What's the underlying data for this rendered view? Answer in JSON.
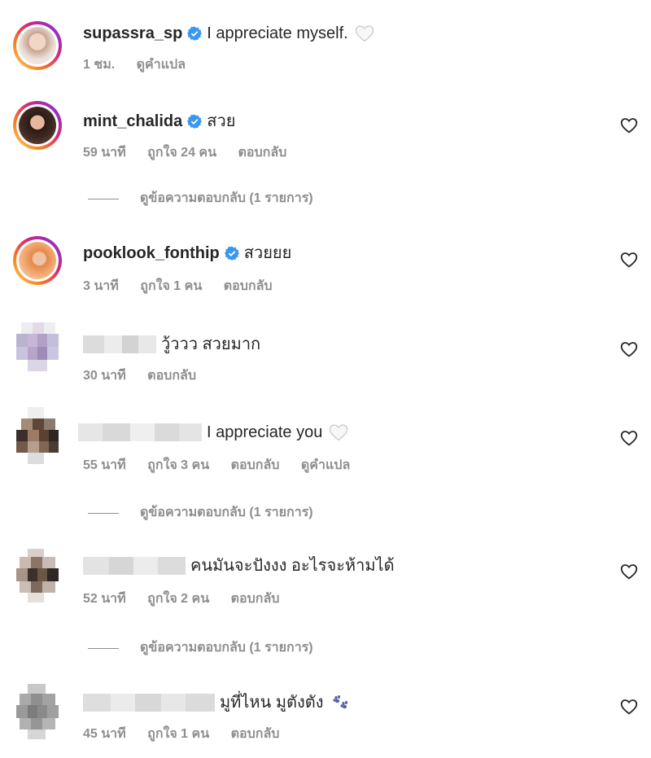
{
  "caption": {
    "username": "supassra_sp",
    "text": "I appreciate myself.",
    "time": "1 ชม.",
    "translate": "ดูคำแปล"
  },
  "comments": [
    {
      "username": "mint_chalida",
      "verified": true,
      "text": "สวย",
      "time": "59 นาที",
      "likes": "ถูกใจ 24 คน",
      "reply": "ตอบกลับ",
      "view_replies": "ดูข้อความตอบกลับ (1 รายการ)"
    },
    {
      "username": "pooklook_fonthip",
      "verified": true,
      "text": "สวยยย",
      "time": "3 นาที",
      "likes": "ถูกใจ 1 คน",
      "reply": "ตอบกลับ"
    },
    {
      "username": "",
      "text": "วู้ววว สวยมาก",
      "time": "30 นาที",
      "reply": "ตอบกลับ"
    },
    {
      "username": "",
      "text": "I appreciate you",
      "time": "55 นาที",
      "likes": "ถูกใจ 3 คน",
      "reply": "ตอบกลับ",
      "translate": "ดูคำแปล",
      "view_replies": "ดูข้อความตอบกลับ (1 รายการ)"
    },
    {
      "username": "",
      "text": "คนมันจะปังงง อะไรจะห้ามได้",
      "time": "52 นาที",
      "likes": "ถูกใจ 2 คน",
      "reply": "ตอบกลับ",
      "view_replies": "ดูข้อความตอบกลับ (1 รายการ)"
    },
    {
      "username": "",
      "text": "มูที่ไหน มูตังตัง",
      "time": "45 นาที",
      "likes": "ถูกใจ 1 คน",
      "reply": "ตอบกลับ"
    }
  ],
  "icons": {
    "verified": "verified-badge-icon",
    "heart": "heart-outline-icon",
    "white_heart_emoji": "white-heart-emoji",
    "paw_emoji": "paw-prints-emoji"
  },
  "colors": {
    "verified_blue": "#3897f0",
    "meta_gray": "#8e8e8e",
    "text": "#262626"
  }
}
